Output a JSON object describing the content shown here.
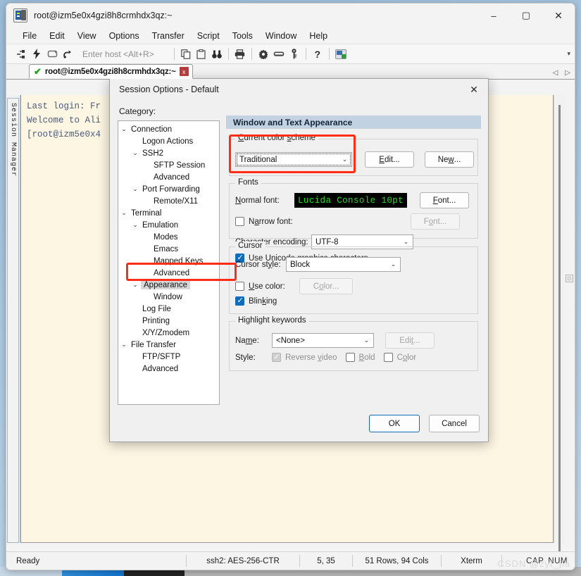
{
  "window": {
    "title": "root@izm5e0x4gzi8h8crmhdx3qz:~",
    "icon": "securecrt-icon",
    "minimize": "–",
    "maximize": "▢",
    "close": "✕"
  },
  "menu": {
    "items": [
      "File",
      "Edit",
      "View",
      "Options",
      "Transfer",
      "Script",
      "Tools",
      "Window",
      "Help"
    ]
  },
  "toolbar": {
    "host_placeholder": "Enter host <Alt+R>",
    "overflow": "▾",
    "icons": [
      "connect-icon",
      "quick-connect-icon",
      "reconnect-icon",
      "connect-sftp-icon",
      "copy-icon",
      "paste-icon",
      "find-icon",
      "print-icon",
      "settings-gear-icon",
      "keyboard-icon",
      "key-icon",
      "help-icon",
      "session-manager-icon"
    ]
  },
  "tab": {
    "status": "✔",
    "label": "root@izm5e0x4gzi8h8crmhdx3qz:~",
    "close": "x",
    "nav_prev": "◁",
    "nav_next": "▷"
  },
  "session_manager": {
    "label": "Session Manager"
  },
  "terminal": {
    "lines": [
      "Last login: Fr",
      "",
      "Welcome to Ali",
      "",
      "[root@izm5e0x4"
    ]
  },
  "status_bar": {
    "ready": "Ready",
    "cipher": "ssh2: AES-256-CTR",
    "position": "5, 35",
    "dimensions": "51 Rows, 94 Cols",
    "emulation": "Xterm",
    "caps": "CAP",
    "num": "NUM",
    "watermark": "CSDN @zyt_jia"
  },
  "dialog": {
    "title": "Session Options - Default",
    "close": "✕",
    "category_label": "Category:",
    "tree": [
      {
        "indent": 0,
        "arrow": "⌄",
        "label": "Connection",
        "selected": false
      },
      {
        "indent": 1,
        "arrow": "",
        "label": "Logon Actions",
        "selected": false
      },
      {
        "indent": 1,
        "arrow": "⌄",
        "label": "SSH2",
        "selected": false
      },
      {
        "indent": 2,
        "arrow": "",
        "label": "SFTP Session",
        "selected": false
      },
      {
        "indent": 2,
        "arrow": "",
        "label": "Advanced",
        "selected": false
      },
      {
        "indent": 1,
        "arrow": "⌄",
        "label": "Port Forwarding",
        "selected": false
      },
      {
        "indent": 2,
        "arrow": "",
        "label": "Remote/X11",
        "selected": false
      },
      {
        "indent": 0,
        "arrow": "⌄",
        "label": "Terminal",
        "selected": false
      },
      {
        "indent": 1,
        "arrow": "⌄",
        "label": "Emulation",
        "selected": false
      },
      {
        "indent": 2,
        "arrow": "",
        "label": "Modes",
        "selected": false
      },
      {
        "indent": 2,
        "arrow": "",
        "label": "Emacs",
        "selected": false
      },
      {
        "indent": 2,
        "arrow": "",
        "label": "Mapped Keys",
        "selected": false
      },
      {
        "indent": 2,
        "arrow": "",
        "label": "Advanced",
        "selected": false
      },
      {
        "indent": 1,
        "arrow": "⌄",
        "label": "Appearance",
        "selected": true
      },
      {
        "indent": 2,
        "arrow": "",
        "label": "Window",
        "selected": false
      },
      {
        "indent": 1,
        "arrow": "",
        "label": "Log File",
        "selected": false
      },
      {
        "indent": 1,
        "arrow": "",
        "label": "Printing",
        "selected": false
      },
      {
        "indent": 1,
        "arrow": "",
        "label": "X/Y/Zmodem",
        "selected": false
      },
      {
        "indent": 0,
        "arrow": "⌄",
        "label": "File Transfer",
        "selected": false
      },
      {
        "indent": 1,
        "arrow": "",
        "label": "FTP/SFTP",
        "selected": false
      },
      {
        "indent": 1,
        "arrow": "",
        "label": "Advanced",
        "selected": false
      }
    ],
    "content_header": "Window and Text Appearance",
    "color_scheme": {
      "legend": "Current color scheme",
      "value": "Traditional",
      "carat": "⌄",
      "edit_button": "Edit...",
      "new_button": "New..."
    },
    "fonts": {
      "legend": "Fonts",
      "normal_font_label": "Normal font:",
      "normal_font_value": "Lucida Console 10pt",
      "normal_font_button": "Font...",
      "narrow_font_label": "Narrow font:",
      "narrow_font_checked": false,
      "narrow_font_button": "Font...",
      "encoding_label": "Character encoding:",
      "encoding_value": "UTF-8",
      "encoding_carat": "⌄",
      "unicode_graphics_label": "Use Unicode graphics characters",
      "unicode_graphics_checked": true
    },
    "cursor": {
      "legend": "Cursor",
      "style_label": "Cursor style:",
      "style_value": "Block",
      "style_carat": "⌄",
      "use_color_label": "Use color:",
      "use_color_checked": false,
      "color_button": "Color...",
      "blinking_label": "Blinking",
      "blinking_checked": true
    },
    "highlight": {
      "legend": "Highlight keywords",
      "name_label": "Name:",
      "name_value": "<None>",
      "name_carat": "⌄",
      "edit_button": "Edit...",
      "style_label": "Style:",
      "reverse_video_label": "Reverse video",
      "reverse_video_checked": true,
      "bold_label": "Bold",
      "bold_checked": false,
      "color_label": "Color",
      "color_checked": false
    },
    "ok_button": "OK",
    "cancel_button": "Cancel"
  },
  "colors": {
    "accent": "#0f6cbd",
    "annotation_red": "#ff2d15",
    "header_bar": "#c2d2e0",
    "terminal_bg": "#fdf6e3",
    "terminal_fg": "#4a5b7a",
    "font_preview_bg": "#000000",
    "font_preview_fg": "#20e020"
  }
}
